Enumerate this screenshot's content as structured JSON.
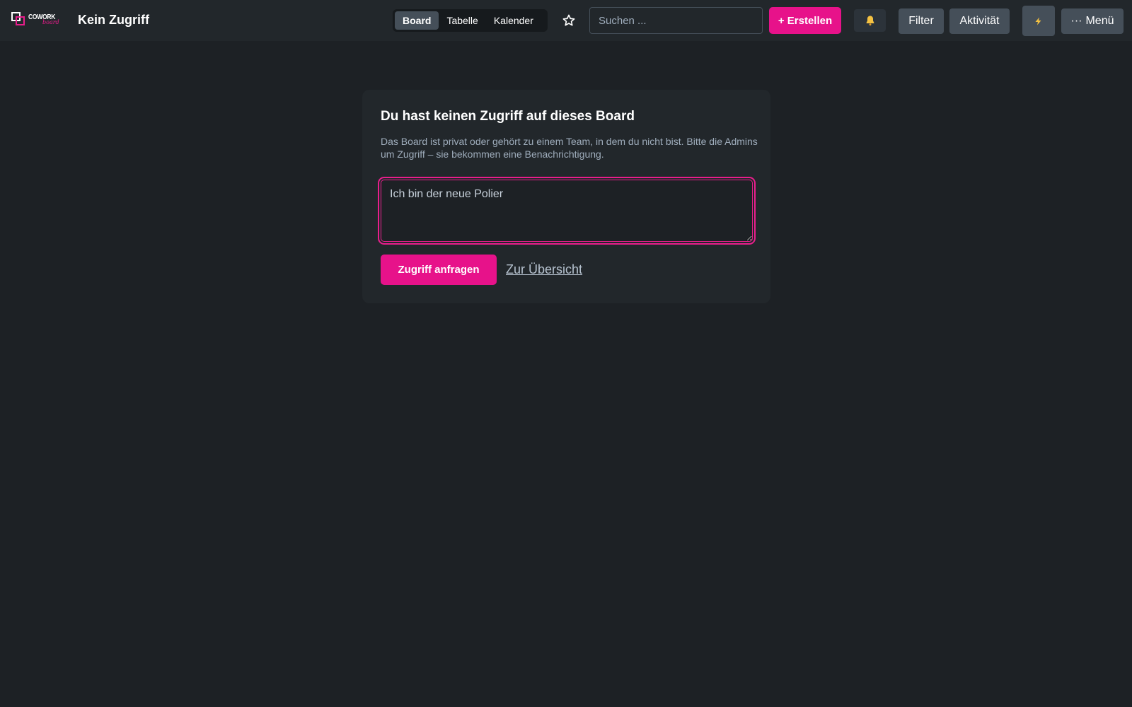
{
  "app": {
    "logo_text": "COWORK",
    "logo_subtext": "board"
  },
  "header": {
    "title": "Kein Zugriff",
    "views": [
      {
        "label": "Board",
        "active": true
      },
      {
        "label": "Tabelle",
        "active": false
      },
      {
        "label": "Kalender",
        "active": false
      }
    ],
    "star_icon": "star-outline-icon",
    "search_placeholder": "Suchen ...",
    "create_label": "+ Erstellen",
    "bell_icon": "bell-icon",
    "filter_label": "Filter",
    "activity_label": "Aktivität",
    "power_icon": "lightning-icon",
    "menu_label": "Menü",
    "menu_prefix": "···"
  },
  "access_card": {
    "title": "Du hast keinen Zugriff auf dieses Board",
    "description": "Das Board ist privat oder gehört zu einem Team, in dem du nicht bist. Bitte die Admins um Zugriff – sie bekommen eine Benachrichtigung.",
    "message_value": "Ich bin der neue Polier",
    "request_label": "Zugriff anfragen",
    "overview_label": "Zur Übersicht"
  },
  "colors": {
    "accent": "#e7128a",
    "background": "#1d2125",
    "surface": "#22272b",
    "button_gray": "#454f59"
  }
}
